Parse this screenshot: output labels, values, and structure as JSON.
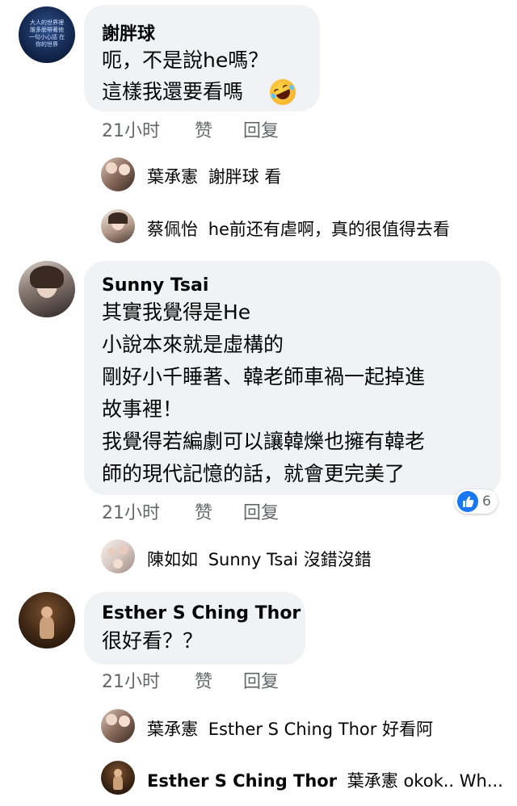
{
  "comments": [
    {
      "author": "謝胖球",
      "lines": [
        "呃，不是說he嗎？",
        "這樣我還要看嗎"
      ],
      "emoji": "🤣",
      "avatar_text": "大人的世界裡 誰多麼帶著他 一句小心話 在你的世界",
      "time": "21小时",
      "like": "赞",
      "reply": "回复",
      "replies": [
        {
          "name": "葉承憲",
          "text": "謝胖球 看"
        },
        {
          "name": "蔡佩怡",
          "text": "he前还有虐啊，真的很值得去看"
        }
      ]
    },
    {
      "author": "Sunny Tsai",
      "lines": [
        "其實我覺得是He",
        "小說本來就是虛構的",
        "剛好小千睡著、韓老師車禍一起掉進",
        "故事裡！",
        "我覺得若編劇可以讓韓爍也擁有韓老",
        "師的現代記憶的話，就會更完美了"
      ],
      "time": "21小时",
      "like": "赞",
      "reply": "回复",
      "reaction_count": "6",
      "replies": [
        {
          "name": "陳如如",
          "text": "Sunny Tsai 沒錯沒錯"
        }
      ]
    },
    {
      "author": "Esther S Ching Thor",
      "lines": [
        "很好看？？"
      ],
      "time": "21小时",
      "like": "赞",
      "reply": "回复",
      "replies": [
        {
          "name": "葉承憲",
          "text": "Esther S Ching Thor 好看阿"
        },
        {
          "name": "Esther S Ching Thor",
          "text": "葉承憲 okok.. Wh..."
        }
      ]
    }
  ],
  "colors": {
    "bubble": "#f0f2f5",
    "meta": "#65676b",
    "text": "#050505",
    "like_blue": "#1877f2"
  }
}
